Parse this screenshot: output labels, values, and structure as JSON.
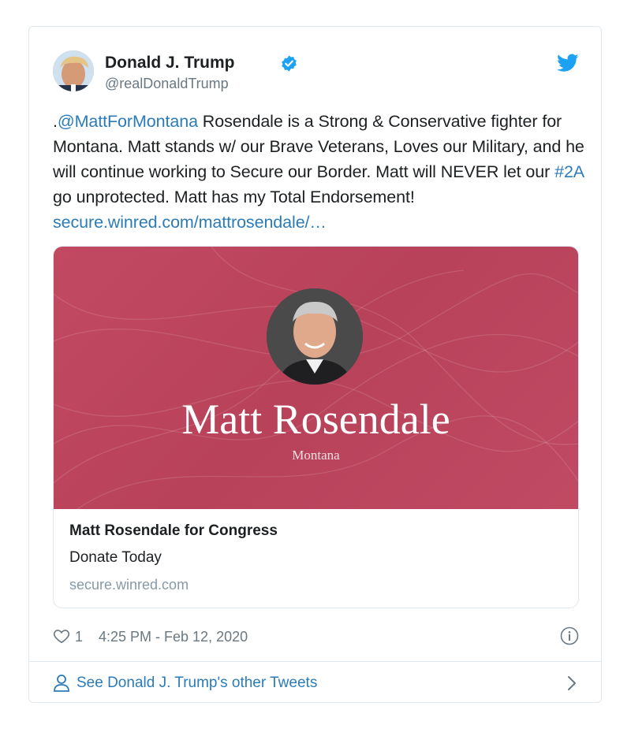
{
  "tweet": {
    "author_name": "Donald J. Trump",
    "handle": "@realDonaldTrump",
    "text_prefix": ".",
    "mention": "@MattForMontana",
    "text_part1": " Rosendale is a Strong & Conservative fighter for Montana. Matt stands w/ our Brave Veterans, Loves our Military, and he will continue working to Secure our Border. Matt will NEVER let our ",
    "hashtag": "#2A",
    "text_part2": " go unprotected. Matt has my Total Endorsement! ",
    "link": "secure.winred.com/mattrosendale/…",
    "likes": "1",
    "timestamp": "4:25 PM - Feb 12, 2020"
  },
  "link_card": {
    "banner_name": "Matt Rosendale",
    "banner_state": "Montana",
    "title": "Matt Rosendale for Congress",
    "description": "Donate Today",
    "domain": "secure.winred.com"
  },
  "footer": {
    "more_tweets_label": "See Donald J. Trump's other Tweets"
  },
  "icons": {
    "verified": "verified-badge-icon",
    "twitter": "twitter-bird-icon",
    "like": "heart-icon",
    "info": "info-icon",
    "profile": "person-icon",
    "chevron": "chevron-right-icon"
  },
  "colors": {
    "link": "#2b7bb9",
    "banner": "#bc4560",
    "secondary_text": "#697882"
  }
}
